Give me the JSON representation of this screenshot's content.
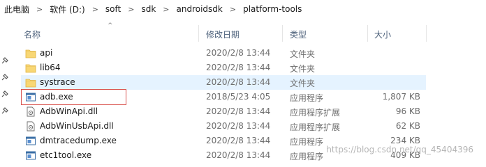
{
  "breadcrumb": [
    "此电脑",
    "软件 (D:)",
    "soft",
    "sdk",
    "androidsdk",
    "platform-tools"
  ],
  "columns": {
    "name": "名称",
    "date": "修改日期",
    "type": "类型",
    "size": "大小"
  },
  "files": [
    {
      "name": "api",
      "date": "2020/2/8 13:44",
      "type": "文件夹",
      "size": "",
      "icon": "folder-icon"
    },
    {
      "name": "lib64",
      "date": "2020/2/8 13:44",
      "type": "文件夹",
      "size": "",
      "icon": "folder-icon"
    },
    {
      "name": "systrace",
      "date": "2020/2/8 13:44",
      "type": "文件夹",
      "size": "",
      "icon": "folder-icon"
    },
    {
      "name": "adb.exe",
      "date": "2018/5/23 4:05",
      "type": "应用程序",
      "size": "1,807 KB",
      "icon": "exe-icon"
    },
    {
      "name": "AdbWinApi.dll",
      "date": "2020/2/8 13:44",
      "type": "应用程序扩展",
      "size": "96 KB",
      "icon": "dll-icon"
    },
    {
      "name": "AdbWinUsbApi.dll",
      "date": "2020/2/8 13:44",
      "type": "应用程序扩展",
      "size": "62 KB",
      "icon": "dll-icon"
    },
    {
      "name": "dmtracedump.exe",
      "date": "2020/2/8 13:44",
      "type": "应用程序",
      "size": "234 KB",
      "icon": "exe-icon"
    },
    {
      "name": "etc1tool.exe",
      "date": "2020/2/8 13:44",
      "type": "应用程序",
      "size": "409 KB",
      "icon": "exe-icon"
    }
  ],
  "watermark": "https://blog.csdn.net/qq_45404396",
  "colors": {
    "selection": "#cce8ff",
    "highlight_border": "#d9534f",
    "folder": "#f8d775"
  }
}
